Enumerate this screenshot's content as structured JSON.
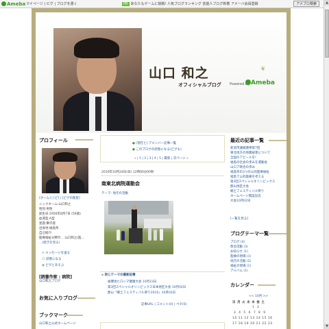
{
  "topbar": {
    "logo": "Ameba",
    "nav": "マイページ | ピグ | ブログを書く",
    "promo_badge": "PR",
    "promo_text": "あなたもゲームに挑戦! 人気ブログランキング 芸能人ブログ新着 アメーバ会員登録",
    "search_button": "アメブロ検索"
  },
  "header": {
    "name": "山口 和之",
    "subtitle": "オフィシャルブログ",
    "powered_by": "Powered by",
    "ameba": "Ameba"
  },
  "profile": {
    "title": "プロフィール",
    "links": "[ホーム] | [ピ] | [ピグの部屋]",
    "lines": [
      "ニックネーム:山口和之",
      "性別:男性",
      "誕生日:1956年8月7日 (56歳)",
      "血液型:A型",
      "星座:獅子座",
      "出身地:福島県",
      "自己紹介:",
      "医療福祉分野の… 山口和之(医…",
      "…(続きを見る)"
    ],
    "message_link": "メッセージを送る",
    "reader_link": "読者になる",
    "pig_link": "ピグとあそぶ"
  },
  "book": {
    "title": "[読書作家 : 病院]",
    "text": "山口和之ブログ"
  },
  "favorites": {
    "title": "お気に入りブログ"
  },
  "bookmark": {
    "title": "ブックマーク",
    "text": "山口和之公式ホームページ"
  },
  "center": {
    "top_link1": "[現在と] アメンバー記事一覧",
    "top_link2": "このブログの読者になる(ピグも)",
    "pager": "« | 1 | 2 | 3 | 4 | 5 | 最新 | 次ページ »",
    "date": "2010年10月24日(日) 12時00分00秒",
    "post_title": "南東北病院運動会",
    "theme": "テーマ: 地元の活動",
    "related_title": "同じテーマの最新記事",
    "related": [
      "被爆地ヒロシマ健康大会 10月23日",
      "第3回スペシャルオリンピックス日本地区大会 10月02日",
      "郡山「郷土フェスティバル祭り2010」10月02日"
    ],
    "footer": "記事URL | コメント(0) | ペタ(0)"
  },
  "recent": {
    "title": "最近の記事一覧",
    "items": [
      "新潟市議補選挙第7回",
      "東北地方の地震被害について",
      "全国のアピールを!",
      "福島の社会の歩みを運動会",
      "山口ア政治の歩み",
      "福島県の3つの公的医療福祉",
      "福島で公的医療を考える",
      "第3回スペシャルオリンピックス",
      "郡山地区大会",
      "郷土フェスティバル祭り",
      "ホームページ開設記念",
      "大会10月02日"
    ],
    "more": "[一覧を見る]"
  },
  "themes": {
    "title": "ブログテーマ一覧",
    "items": [
      "ブログ (4)",
      "政治活動 (3)",
      "お知らせ (1)",
      "医療の現場 (1)",
      "地元の活動 (2)",
      "福祉の現場 (1)",
      "アルバム (1)"
    ]
  },
  "calendar": {
    "title": "カレンダー",
    "month": "<< 10月 >>",
    "weekdays": "日 月 火 水 木 金 土",
    "rows": [
      "               1  2",
      " 3  4  5  6  7  8  9",
      "10 11 12 13 14 15 16",
      "17 18 19 20 21 22 23"
    ]
  },
  "colors": {
    "frame": "#b8ad7c",
    "ameba_green": "#3a9d23",
    "link": "#2a5c9a"
  }
}
